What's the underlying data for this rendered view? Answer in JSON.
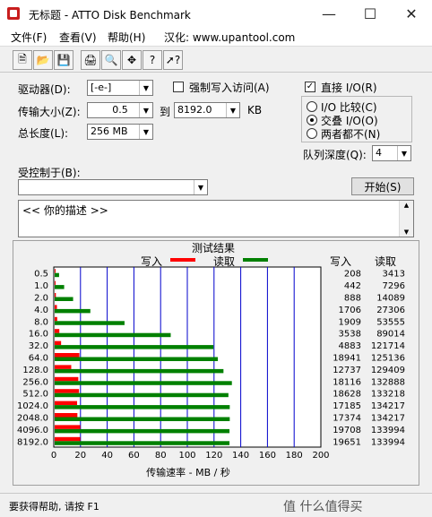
{
  "window": {
    "title": "无标题 - ATTO Disk Benchmark"
  },
  "menu": [
    "文件(F)",
    "查看(V)",
    "帮助(H)",
    "汉化: www.upantool.com"
  ],
  "toolbar": {
    "buttons": [
      "new-icon",
      "open-icon",
      "save-icon",
      "print-icon",
      "preview-icon",
      "move-icon",
      "help-icon",
      "context-help-icon"
    ]
  },
  "settings": {
    "drive_label": "驱动器(D):",
    "drive_value": "[-e-]",
    "force_write_label": "强制写入访问(A)",
    "transfer_label": "传输大小(Z):",
    "transfer_from": "0.5",
    "to_label": "到",
    "transfer_to": "8192.0",
    "kb_label": "KB",
    "total_label": "总长度(L):",
    "total_value": "256 MB",
    "direct_io_label": "直接 I/O(R)",
    "io_options": [
      "I/O 比较(C)",
      "交叠 I/O(O)",
      "两者都不(N)"
    ],
    "queue_label": "队列深度(Q):",
    "queue_value": "4",
    "controlled_label": "受控制于(B):",
    "controlled_value": "",
    "start_button": "开始(S)",
    "description": "<<  你的描述  >>"
  },
  "results": {
    "title": "测试结果",
    "legend_write": "写入",
    "legend_read": "读取",
    "col_write": "写入",
    "col_read": "读取",
    "xlabel": "传输速率 - MB / 秒",
    "write_color": "#ff0000",
    "read_color": "#008000"
  },
  "chart_data": {
    "type": "bar",
    "title": "测试结果",
    "xlabel": "传输速率 - MB / 秒",
    "xlim": [
      0,
      200
    ],
    "x_ticks": [
      "0",
      "20",
      "40",
      "60",
      "80",
      "100",
      "120",
      "140",
      "160",
      "180",
      "200"
    ],
    "categories": [
      "0.5",
      "1.0",
      "2.0",
      "4.0",
      "8.0",
      "16.0",
      "32.0",
      "64.0",
      "128.0",
      "256.0",
      "512.0",
      "1024.0",
      "2048.0",
      "4096.0",
      "8192.0"
    ],
    "series": [
      {
        "name": "写入",
        "values": [
          0.2,
          0.4,
          0.9,
          1.7,
          1.9,
          3.5,
          4.8,
          18.5,
          12.4,
          17.7,
          18.2,
          16.8,
          17.0,
          19.2,
          19.2
        ]
      },
      {
        "name": "读取",
        "values": [
          3.3,
          7.1,
          13.8,
          26.7,
          52.3,
          86.9,
          118.9,
          122.2,
          126.4,
          132.7,
          130.1,
          131.1,
          131.1,
          130.9,
          130.9
        ]
      }
    ],
    "write_table": [
      "208",
      "442",
      "888",
      "1706",
      "1909",
      "3538",
      "4883",
      "18941",
      "12737",
      "18116",
      "18628",
      "17185",
      "17374",
      "19708",
      "19651"
    ],
    "read_table": [
      "3413",
      "7296",
      "14089",
      "27306",
      "53555",
      "89014",
      "121714",
      "125136",
      "129409",
      "132888",
      "133218",
      "134217",
      "134217",
      "133994",
      "133994"
    ]
  },
  "status": {
    "text": "要获得帮助, 请按 F1",
    "watermark": "值 什么值得买"
  }
}
